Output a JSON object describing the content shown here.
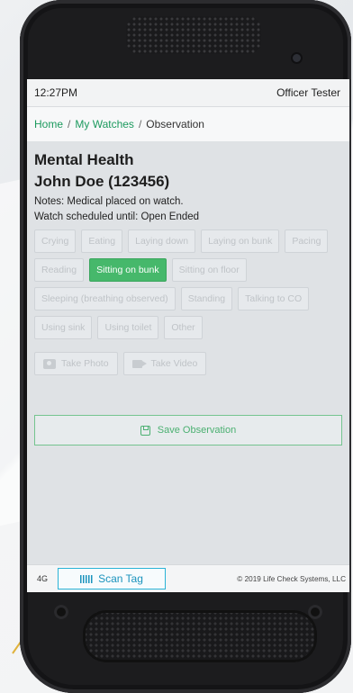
{
  "status_bar": {
    "time": "12:27PM",
    "user": "Officer Tester"
  },
  "breadcrumb": {
    "home": "Home",
    "watches": "My Watches",
    "current": "Observation",
    "separator": "/"
  },
  "watch": {
    "type": "Mental Health",
    "subject": "John Doe (123456)",
    "notes": "Notes: Medical placed on watch.",
    "schedule": "Watch scheduled until: Open Ended"
  },
  "observations": [
    {
      "label": "Crying",
      "selected": false
    },
    {
      "label": "Eating",
      "selected": false
    },
    {
      "label": "Laying down",
      "selected": false
    },
    {
      "label": "Laying on bunk",
      "selected": false
    },
    {
      "label": "Pacing",
      "selected": false
    },
    {
      "label": "Reading",
      "selected": false
    },
    {
      "label": "Sitting on bunk",
      "selected": true
    },
    {
      "label": "Sitting on floor",
      "selected": false
    },
    {
      "label": "Sleeping (breathing observed)",
      "selected": false
    },
    {
      "label": "Standing",
      "selected": false
    },
    {
      "label": "Talking to CO",
      "selected": false
    },
    {
      "label": "Using sink",
      "selected": false
    },
    {
      "label": "Using toilet",
      "selected": false
    },
    {
      "label": "Other",
      "selected": false
    }
  ],
  "media": {
    "photo_label": "Take Photo",
    "photo_icon": "camera-icon",
    "video_label": "Take Video",
    "video_icon": "video-camera-icon"
  },
  "save": {
    "label": "Save Observation",
    "icon": "floppy-disk-icon"
  },
  "footer": {
    "network": "4G",
    "scan_label": "Scan Tag",
    "scan_icon": "barcode-icon",
    "copyright": "© 2019 Life Check Systems, LLC"
  },
  "colors": {
    "accent_green": "#46b86b",
    "link_green": "#1c9a5e",
    "scan_blue": "#2bb3d6"
  }
}
